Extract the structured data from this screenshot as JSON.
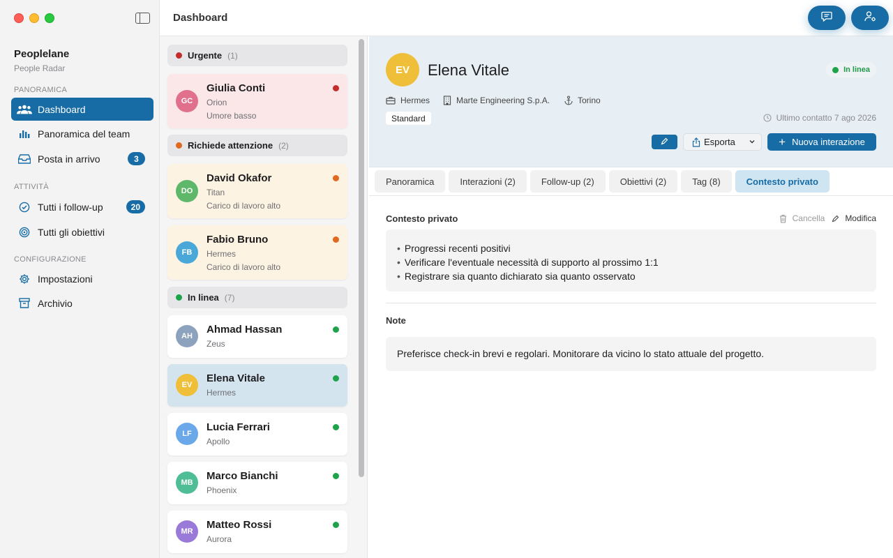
{
  "app": {
    "name": "Peoplelane",
    "subtitle": "People Radar"
  },
  "topbar": {
    "title": "Dashboard"
  },
  "sidebar": {
    "sections": [
      {
        "label": "PANORAMICA",
        "items": [
          {
            "label": "Dashboard",
            "icon": "people-icon",
            "active": true
          },
          {
            "label": "Panoramica del team",
            "icon": "bar-chart-icon"
          },
          {
            "label": "Posta in arrivo",
            "icon": "inbox-icon",
            "badge": "3"
          }
        ]
      },
      {
        "label": "ATTIVITÀ",
        "items": [
          {
            "label": "Tutti i follow-up",
            "icon": "check-circle-icon",
            "badge": "20"
          },
          {
            "label": "Tutti gli obiettivi",
            "icon": "target-icon"
          }
        ]
      },
      {
        "label": "CONFIGURAZIONE",
        "items": [
          {
            "label": "Impostazioni",
            "icon": "gear-icon"
          },
          {
            "label": "Archivio",
            "icon": "archive-icon"
          }
        ]
      }
    ]
  },
  "groups": [
    {
      "label": "Urgente",
      "count": "(1)",
      "color": "#c42b2b"
    },
    {
      "label": "Richiede attenzione",
      "count": "(2)",
      "color": "#e0691f"
    },
    {
      "label": "In linea",
      "count": "(7)",
      "color": "#1fa34a"
    }
  ],
  "people": [
    {
      "initials": "GC",
      "name": "Giulia Conti",
      "team": "Orion",
      "note": "Umore basso",
      "avatar_color": "#e0708b",
      "status_color": "#c42b2b",
      "bg": "#fbe7e8"
    },
    {
      "initials": "DO",
      "name": "David Okafor",
      "team": "Titan",
      "note": "Carico di lavoro alto",
      "avatar_color": "#5fb86a",
      "status_color": "#e0691f",
      "bg": "#fdf3e2"
    },
    {
      "initials": "FB",
      "name": "Fabio Bruno",
      "team": "Hermes",
      "note": "Carico di lavoro alto",
      "avatar_color": "#4aa8d8",
      "status_color": "#e0691f",
      "bg": "#fdf3e2"
    },
    {
      "initials": "AH",
      "name": "Ahmad Hassan",
      "team": "Zeus",
      "avatar_color": "#8da2bd",
      "status_color": "#1fa34a",
      "bg": "#ffffff"
    },
    {
      "initials": "EV",
      "name": "Elena Vitale",
      "team": "Hermes",
      "avatar_color": "#efbf39",
      "status_color": "#1fa34a",
      "bg": "#d3e4ee"
    },
    {
      "initials": "LF",
      "name": "Lucia Ferrari",
      "team": "Apollo",
      "avatar_color": "#6aa8ea",
      "status_color": "#1fa34a",
      "bg": "#ffffff"
    },
    {
      "initials": "MB",
      "name": "Marco Bianchi",
      "team": "Phoenix",
      "avatar_color": "#4fbd96",
      "status_color": "#1fa34a",
      "bg": "#ffffff"
    },
    {
      "initials": "MR",
      "name": "Matteo Rossi",
      "team": "Aurora",
      "avatar_color": "#9a7ad8",
      "status_color": "#1fa34a",
      "bg": "#ffffff"
    }
  ],
  "detail": {
    "initials": "EV",
    "name": "Elena Vitale",
    "status": "In linea",
    "team": "Hermes",
    "company": "Marte Engineering S.p.A.",
    "location": "Torino",
    "tier": "Standard",
    "last_contact": "Ultimo contatto 7 ago 2026",
    "export_label": "Esporta",
    "new_interaction_label": "Nuova interazione",
    "tabs": [
      "Panoramica",
      "Interazioni (2)",
      "Follow-up (2)",
      "Obiettivi (2)",
      "Tag (8)",
      "Contesto privato"
    ],
    "active_tab": 5,
    "private_context": {
      "title": "Contesto privato",
      "delete_label": "Cancella",
      "edit_label": "Modifica",
      "bullets": [
        "Progressi recenti positivi",
        "Verificare l'eventuale necessità di supporto al prossimo 1:1",
        "Registrare sia quanto dichiarato sia quanto osservato"
      ]
    },
    "notes": {
      "title": "Note",
      "text": "Preferisce check-in brevi e regolari. Monitorare da vicino lo stato attuale del progetto."
    }
  }
}
